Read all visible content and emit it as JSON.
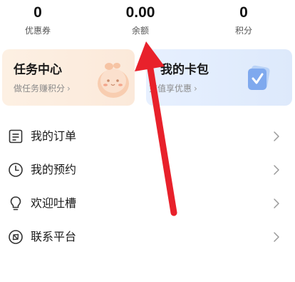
{
  "stats": [
    {
      "value": "0",
      "label": "优惠券"
    },
    {
      "value": "0.00",
      "label": "余额"
    },
    {
      "value": "0",
      "label": "积分"
    }
  ],
  "cards": {
    "task": {
      "title": "任务中心",
      "subtitle": "做任务赚积分",
      "icon": "mascot-icon"
    },
    "wallet": {
      "title": "我的卡包",
      "subtitle": "充值享优惠",
      "icon": "card-wallet-icon"
    }
  },
  "menu": [
    {
      "label": "我的订单",
      "icon": "order-list-icon"
    },
    {
      "label": "我的预约",
      "icon": "clock-icon"
    },
    {
      "label": "欢迎吐槽",
      "icon": "lightbulb-icon"
    },
    {
      "label": "联系平台",
      "icon": "compass-icon"
    }
  ],
  "colors": {
    "annotation_arrow": "#e8212b",
    "task_card_bg": "#fdf0e3",
    "wallet_card_bg": "#e7f0ff"
  }
}
